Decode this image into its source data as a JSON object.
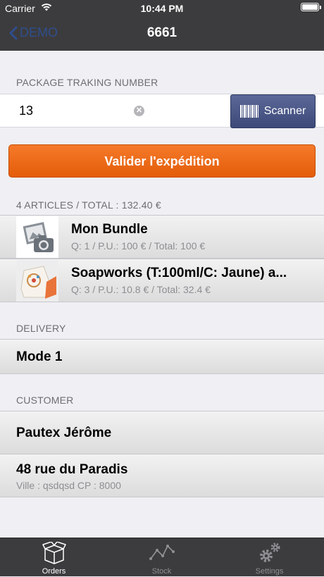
{
  "status_bar": {
    "carrier": "Carrier",
    "time": "10:44 PM"
  },
  "nav": {
    "back_label": "DEMO",
    "title": "6661"
  },
  "tracking": {
    "section_label": "PACKAGE TRAKING NUMBER",
    "value": "13",
    "scanner_label": "Scanner"
  },
  "validate_button": "Valider l'expédition",
  "articles": {
    "header": "4 ARTICLES / TOTAL : 132.40 €",
    "items": [
      {
        "title": "Mon Bundle",
        "subtitle": "Q: 1 / P.U.: 100 € / Total: 100 €",
        "thumb": "camera-placeholder-icon"
      },
      {
        "title": "Soapworks (T:100ml/C: Jaune) a...",
        "subtitle": "Q: 3 / P.U.: 10.8 € / Total: 32.4 €",
        "thumb": "product-photo"
      }
    ]
  },
  "delivery": {
    "header": "DELIVERY",
    "mode": "Mode 1"
  },
  "customer": {
    "header": "CUSTOMER",
    "name": "Pautex Jérôme",
    "address": "48 rue du Paradis",
    "city_line": "Ville : qsdqsd CP : 8000"
  },
  "tabbar": {
    "tabs": [
      {
        "label": "Orders",
        "icon": "box-icon",
        "active": true
      },
      {
        "label": "Stock",
        "icon": "line-chart-icon",
        "active": false
      },
      {
        "label": "Settings",
        "icon": "gears-icon",
        "active": false
      }
    ]
  },
  "colors": {
    "accent": "#ef6a16",
    "bar": "#3c3c3e",
    "scanner": "#4a5688",
    "back_link": "#2f4e8c"
  }
}
